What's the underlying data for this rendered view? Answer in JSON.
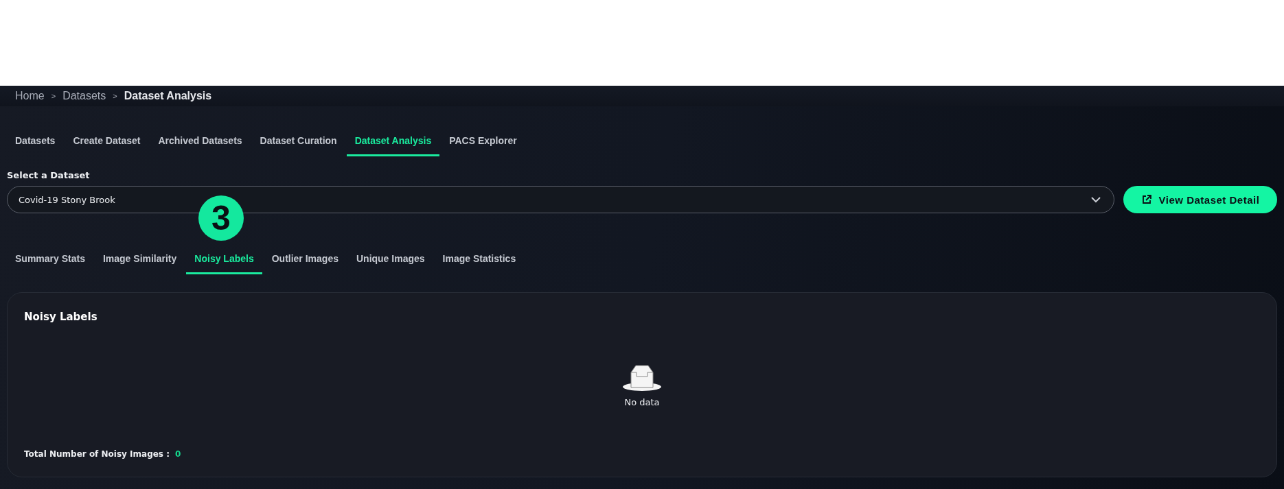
{
  "breadcrumb": [
    {
      "label": "Home",
      "current": false
    },
    {
      "label": "Datasets",
      "current": false
    },
    {
      "label": "Dataset Analysis",
      "current": true
    }
  ],
  "breadcrumb_separator": ">",
  "nav_tabs": [
    {
      "label": "Datasets",
      "selected": false
    },
    {
      "label": "Create Dataset",
      "selected": false
    },
    {
      "label": "Archived Datasets",
      "selected": false
    },
    {
      "label": "Dataset Curation",
      "selected": false
    },
    {
      "label": "Dataset Analysis",
      "selected": true
    },
    {
      "label": "PACS Explorer",
      "selected": false
    }
  ],
  "dataset_select": {
    "label": "Select a Dataset",
    "value": "Covid-19 Stony Brook"
  },
  "view_button": {
    "label": "View Dataset Detail"
  },
  "step_badge": "3",
  "analysis_tabs": [
    {
      "label": "Summary Stats",
      "selected": false
    },
    {
      "label": "Image Similarity",
      "selected": false
    },
    {
      "label": "Noisy Labels",
      "selected": true
    },
    {
      "label": "Outlier Images",
      "selected": false
    },
    {
      "label": "Unique Images",
      "selected": false
    },
    {
      "label": "Image Statistics",
      "selected": false
    }
  ],
  "card": {
    "title": "Noisy Labels",
    "empty_text": "No data",
    "total_label": "Total Number of Noisy Images :",
    "total_value": "0"
  }
}
